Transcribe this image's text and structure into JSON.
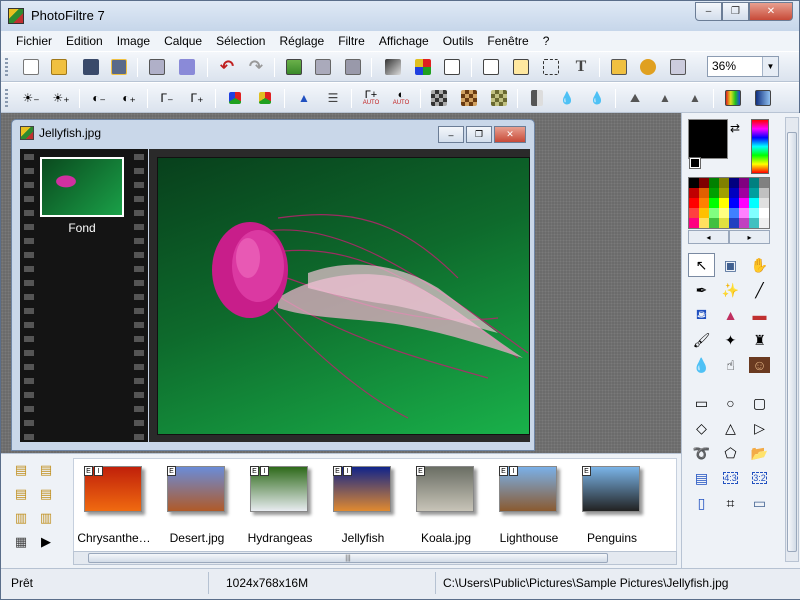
{
  "window": {
    "title": "PhotoFiltre 7",
    "min": "–",
    "max": "❐",
    "close": "✕"
  },
  "menu": [
    "Fichier",
    "Edition",
    "Image",
    "Calque",
    "Sélection",
    "Réglage",
    "Filtre",
    "Affichage",
    "Outils",
    "Fenêtre",
    "?"
  ],
  "toolbar": {
    "zoom_value": "36%",
    "auto_label": "AUTO"
  },
  "document": {
    "title": "Jellyfish.jpg",
    "min": "–",
    "max": "❐",
    "close": "✕",
    "layer_label": "Fond"
  },
  "browser": {
    "items": [
      {
        "label": "Chrysanthe…",
        "badges": [
          "E",
          "I"
        ],
        "colors": [
          "#c0200a",
          "#f06a10"
        ]
      },
      {
        "label": "Desert.jpg",
        "badges": [
          "E"
        ],
        "colors": [
          "#6a8cd8",
          "#b05a28"
        ]
      },
      {
        "label": "Hydrangeas",
        "badges": [
          "E",
          "I"
        ],
        "colors": [
          "#2e6a1a",
          "#e8ecf0"
        ]
      },
      {
        "label": "Jellyfish",
        "badges": [
          "E",
          "I"
        ],
        "colors": [
          "#10248a",
          "#e08a30"
        ]
      },
      {
        "label": "Koala.jpg",
        "badges": [
          "E"
        ],
        "colors": [
          "#6a6e64",
          "#c8c4b8"
        ]
      },
      {
        "label": "Lighthouse",
        "badges": [
          "E",
          "I"
        ],
        "colors": [
          "#7ab0e8",
          "#8a5a30"
        ]
      },
      {
        "label": "Penguins",
        "badges": [
          "E"
        ],
        "colors": [
          "#7ab4e8",
          "#222222"
        ]
      }
    ]
  },
  "status": {
    "state": "Prêt",
    "dimensions": "1024x768x16M",
    "path": "C:\\Users\\Public\\Pictures\\Sample Pictures\\Jellyfish.jpg"
  }
}
